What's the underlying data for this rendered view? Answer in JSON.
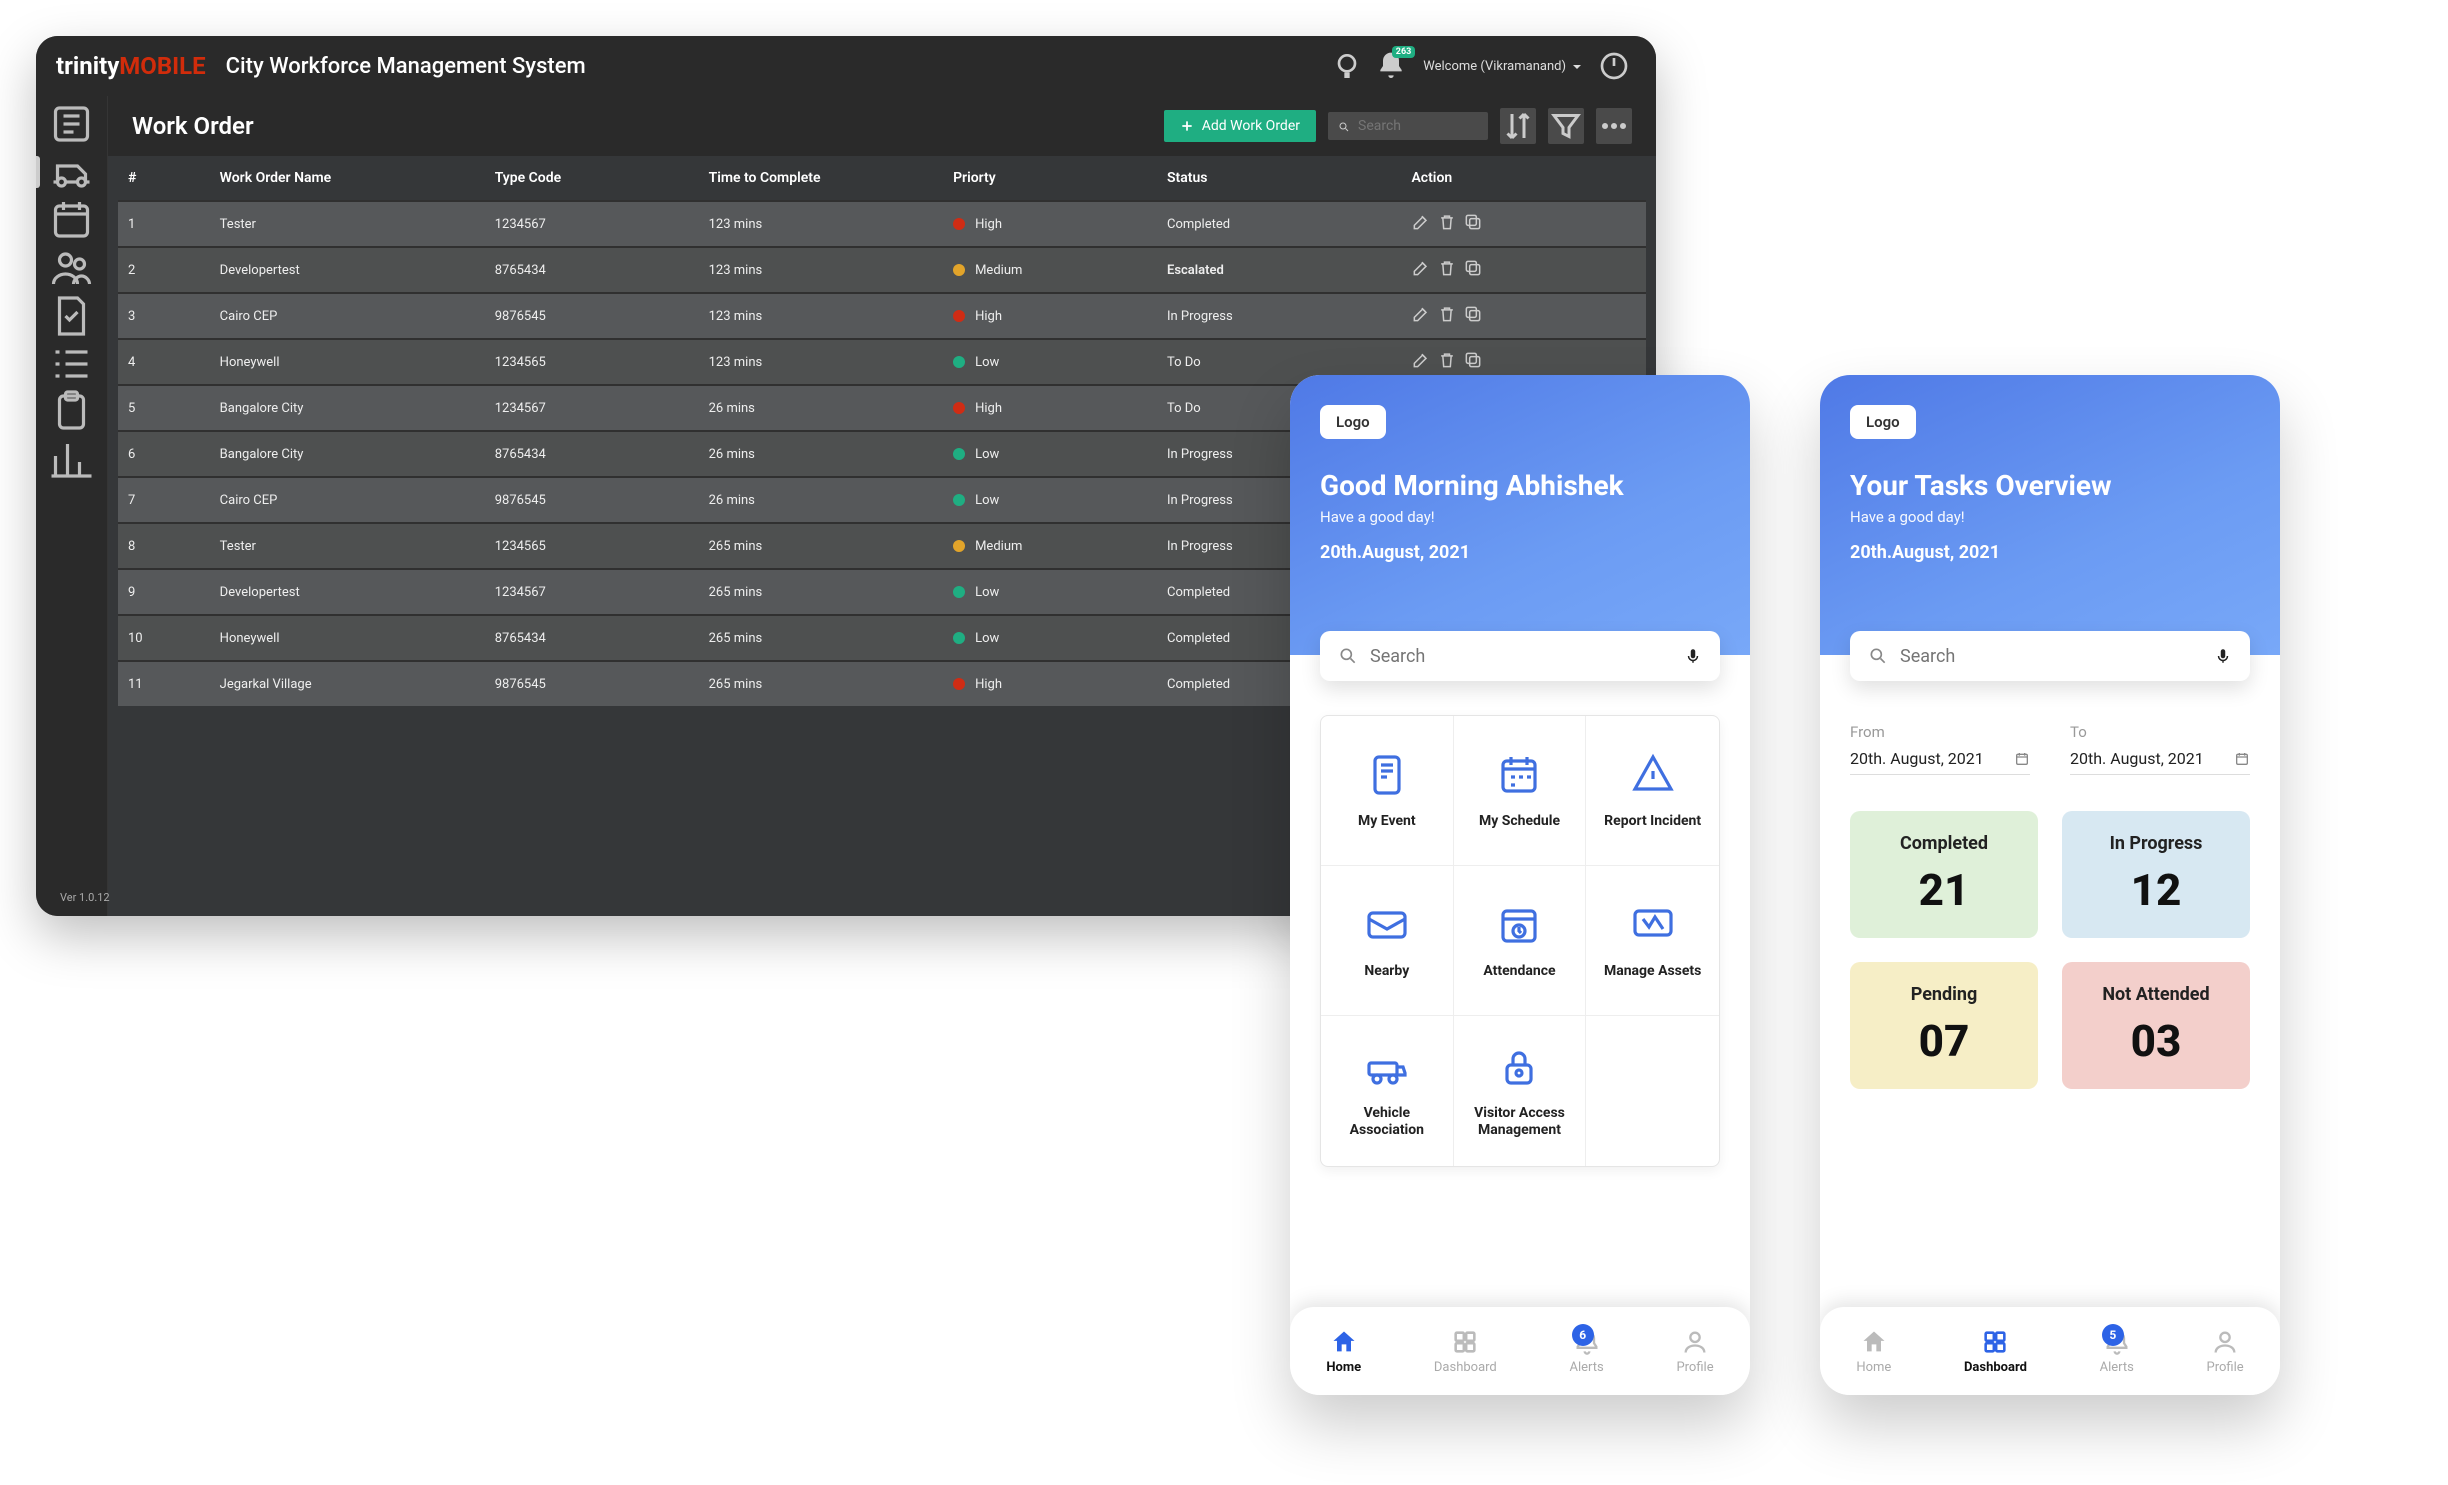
{
  "header": {
    "brand_prefix": "trinity",
    "brand_accent": "MOBILE",
    "app_title": "City Workforce Management System",
    "welcome_text": "Welcome (Vikramanand)",
    "noti_badge": "263"
  },
  "page": {
    "title": "Work Order",
    "add_button": "Add Work Order",
    "search_placeholder": "Search",
    "footer_version": "Ver 1.0.12"
  },
  "table": {
    "columns": {
      "num": "#",
      "name": "Work Order Name",
      "type": "Type Code",
      "time": "Time to Complete",
      "priority": "Priorty",
      "status": "Status",
      "action": "Action"
    },
    "rows": [
      {
        "n": "1",
        "name": "Tester",
        "type": "1234567",
        "time": "123 mins",
        "prio": "High",
        "status": "Completed",
        "status_class": "Completed"
      },
      {
        "n": "2",
        "name": "Developertest",
        "type": "8765434",
        "time": "123 mins",
        "prio": "Medium",
        "status": "Escalated",
        "status_class": "Escalated"
      },
      {
        "n": "3",
        "name": "Cairo CEP",
        "type": "9876545",
        "time": "123 mins",
        "prio": "High",
        "status": "In Progress",
        "status_class": "InProgress"
      },
      {
        "n": "4",
        "name": "Honeywell",
        "type": "1234565",
        "time": "123 mins",
        "prio": "Low",
        "status": "To Do",
        "status_class": "ToDo"
      },
      {
        "n": "5",
        "name": "Bangalore City",
        "type": "1234567",
        "time": "26 mins",
        "prio": "High",
        "status": "To Do",
        "status_class": "ToDo"
      },
      {
        "n": "6",
        "name": "Bangalore City",
        "type": "8765434",
        "time": "26 mins",
        "prio": "Low",
        "status": "In Progress",
        "status_class": "InProgress"
      },
      {
        "n": "7",
        "name": "Cairo CEP",
        "type": "9876545",
        "time": "26 mins",
        "prio": "Low",
        "status": "In Progress",
        "status_class": "InProgress"
      },
      {
        "n": "8",
        "name": "Tester",
        "type": "1234565",
        "time": "265 mins",
        "prio": "Medium",
        "status": "In Progress",
        "status_class": "InProgress"
      },
      {
        "n": "9",
        "name": "Developertest",
        "type": "1234567",
        "time": "265 mins",
        "prio": "Low",
        "status": "Completed",
        "status_class": "Completed"
      },
      {
        "n": "10",
        "name": "Honeywell",
        "type": "8765434",
        "time": "265 mins",
        "prio": "Low",
        "status": "Completed",
        "status_class": "Completed"
      },
      {
        "n": "11",
        "name": "Jegarkal Village",
        "type": "9876545",
        "time": "265 mins",
        "prio": "High",
        "status": "Completed",
        "status_class": "Completed"
      }
    ]
  },
  "mobile1": {
    "logo": "Logo",
    "title": "Good Morning Abhishek",
    "sub": "Have a good day!",
    "date": "20th.August, 2021",
    "search_placeholder": "Search",
    "tiles": [
      "My Event",
      "My Schedule",
      "Report Incident",
      "Nearby",
      "Attendance",
      "Manage Assets",
      "Vehicle Association",
      "Visitor Access Management",
      ""
    ],
    "tabs": [
      "Home",
      "Dashboard",
      "Alerts",
      "Profile"
    ],
    "alerts_count": "6",
    "active_tab": 0
  },
  "mobile2": {
    "logo": "Logo",
    "title": "Your Tasks Overview",
    "sub": "Have a good day!",
    "date": "20th.August, 2021",
    "search_placeholder": "Search",
    "from_label": "From",
    "from_value": "20th. August, 2021",
    "to_label": "To",
    "to_value": "20th. August, 2021",
    "stats": [
      {
        "label": "Completed",
        "value": "21",
        "class": "Completed"
      },
      {
        "label": "In Progress",
        "value": "12",
        "class": "InProgress"
      },
      {
        "label": "Pending",
        "value": "07",
        "class": "Pending"
      },
      {
        "label": "Not Attended",
        "value": "03",
        "class": "NotAttended"
      }
    ],
    "tabs": [
      "Home",
      "Dashboard",
      "Alerts",
      "Profile"
    ],
    "alerts_count": "5",
    "active_tab": 1
  }
}
